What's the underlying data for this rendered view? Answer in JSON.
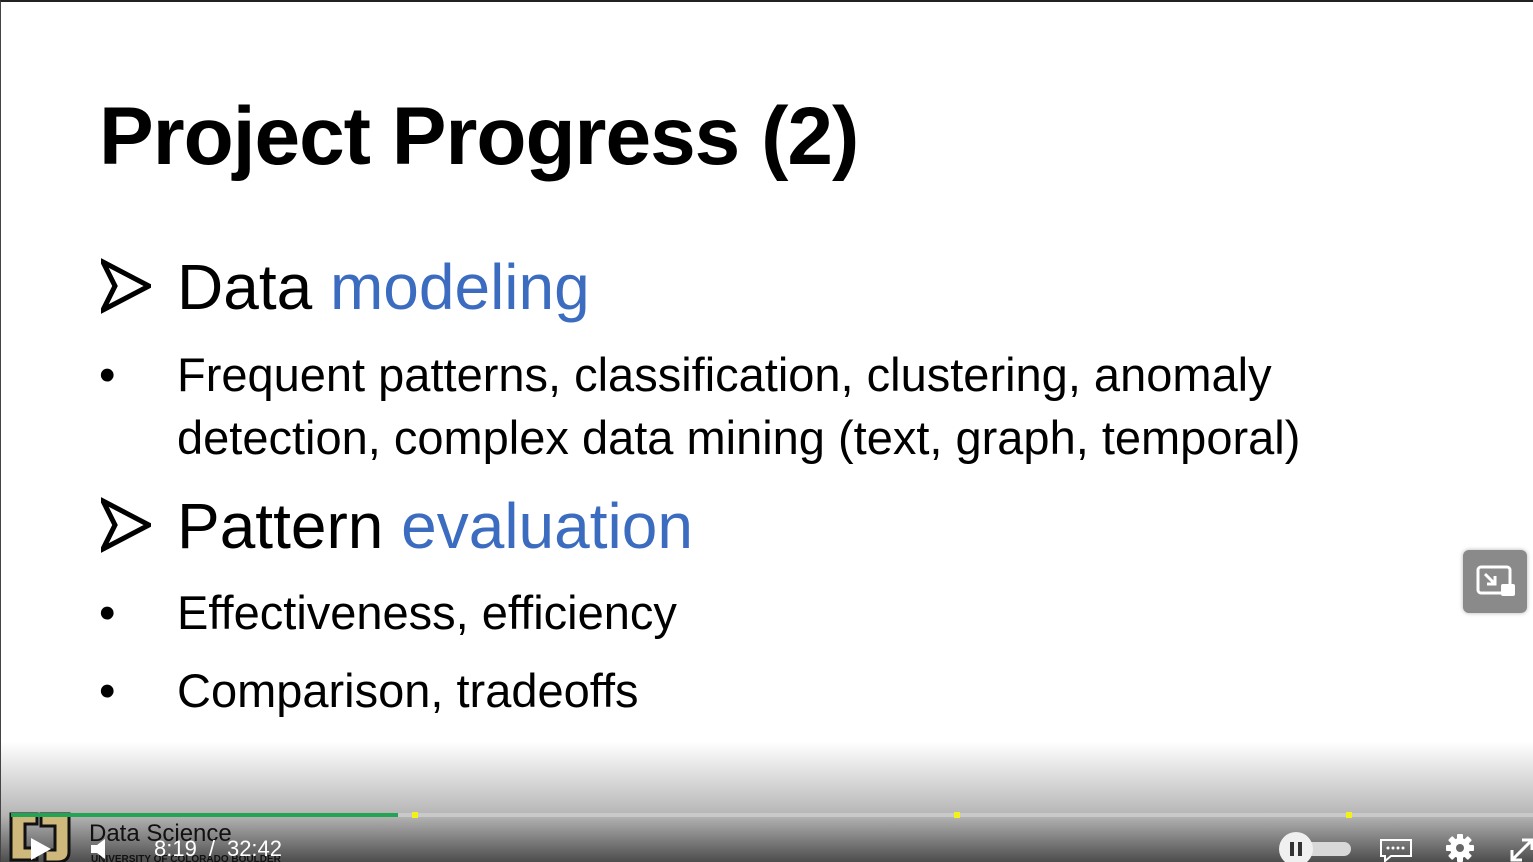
{
  "slide": {
    "title": "Project Progress (2)",
    "sections": [
      {
        "heading_plain": "Data",
        "heading_accent": "modeling",
        "bullets": [
          "Frequent patterns, classification, clustering, anomaly",
          "detection, complex data mining (text, graph, temporal)"
        ]
      },
      {
        "heading_plain": "Pattern",
        "heading_accent": "evaluation",
        "bullets": [
          "Effectiveness, efficiency",
          "Comparison, tradeoffs"
        ]
      }
    ],
    "accent_color": "#3b6cc0"
  },
  "player": {
    "current_time": "8:19",
    "separator": "/",
    "duration": "32:42",
    "progress_fraction": 0.254,
    "played_color": "#23a455",
    "chapter_marker_color": "#f2f21a",
    "logo": {
      "title": "Data Science",
      "subtitle": "UNIVERSITY OF COLORADO BOULDER"
    },
    "icons": [
      "play-icon",
      "volume-icon",
      "pip-icon",
      "pause-toggle-icon",
      "captions-icon",
      "settings-gear-icon",
      "fullscreen-icon"
    ]
  }
}
